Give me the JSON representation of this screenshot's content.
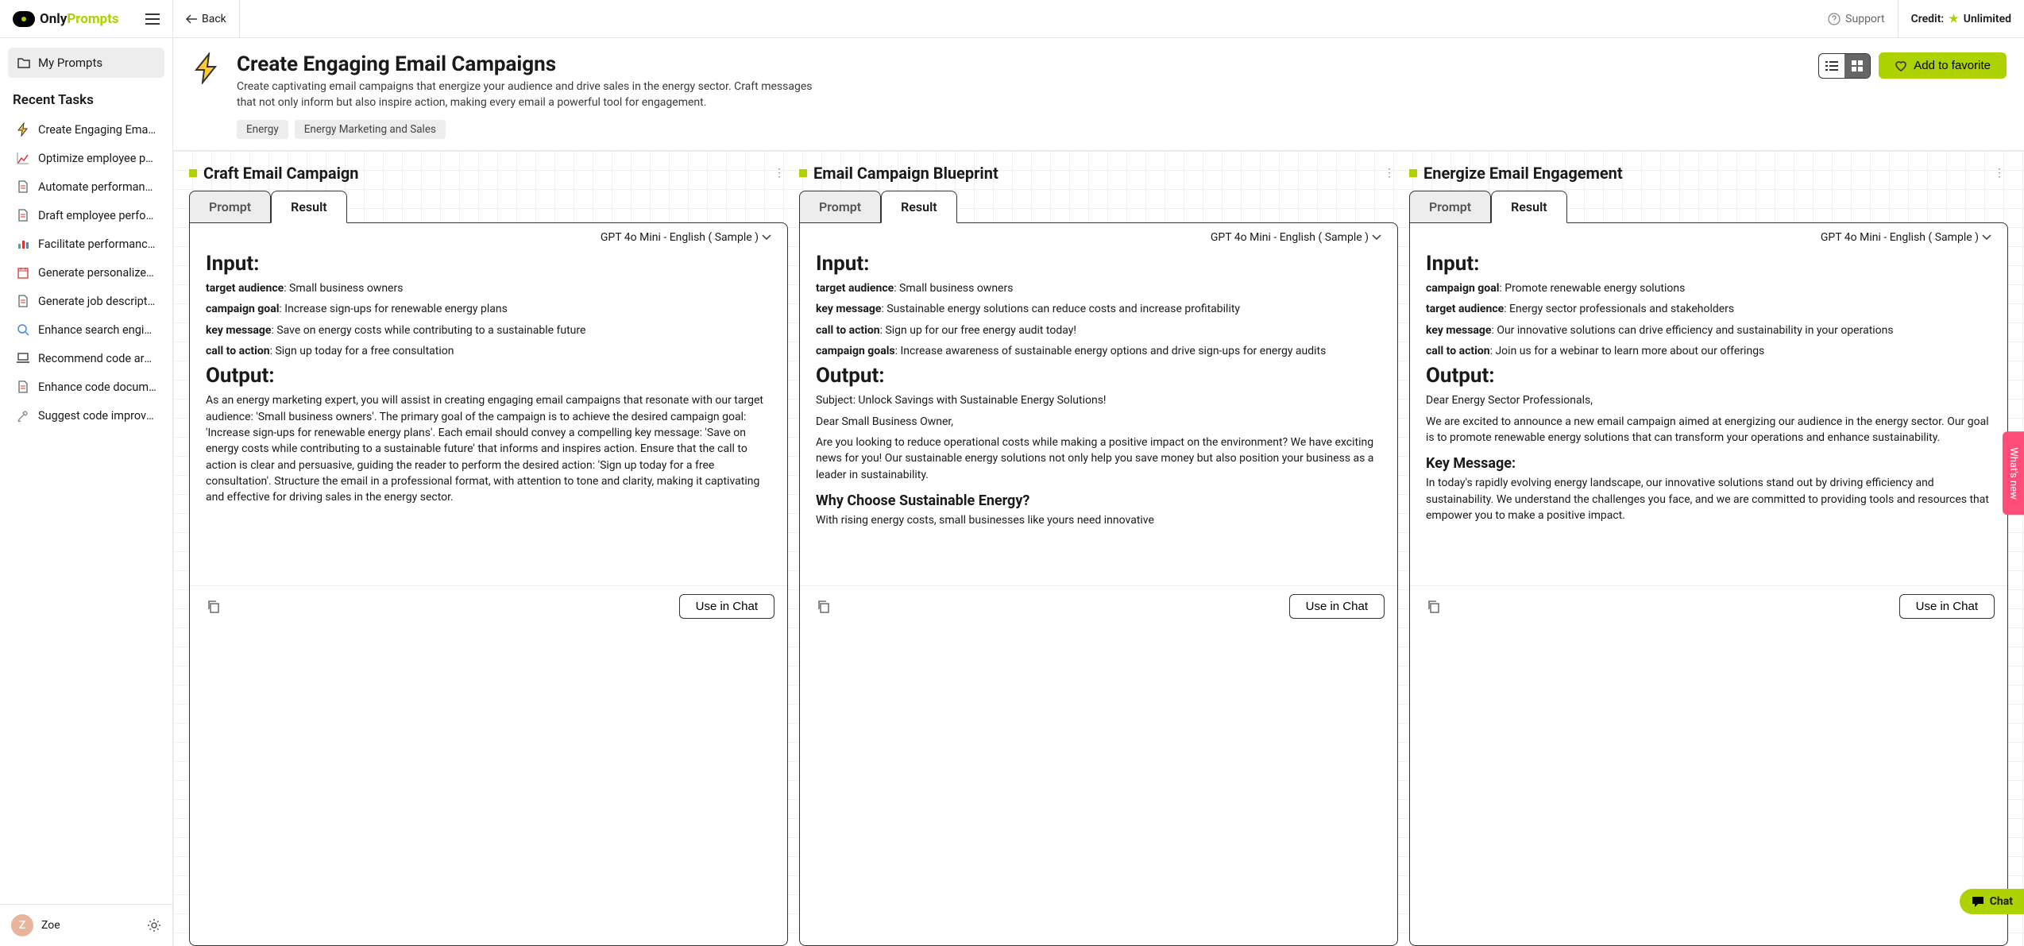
{
  "logo": {
    "only": "Only",
    "prompts": "Prompts"
  },
  "sidebar": {
    "myPrompts": "My Prompts",
    "recentHeading": "Recent Tasks",
    "items": [
      {
        "label": "Create Engaging Email C…",
        "icon": "bolt"
      },
      {
        "label": "Optimize employee perf…",
        "icon": "chart"
      },
      {
        "label": "Automate performance r…",
        "icon": "doc"
      },
      {
        "label": "Draft employee perform…",
        "icon": "doc"
      },
      {
        "label": "Facilitate performance r…",
        "icon": "bars"
      },
      {
        "label": "Generate personalized o…",
        "icon": "calendar"
      },
      {
        "label": "Generate job description…",
        "icon": "doc"
      },
      {
        "label": "Enhance search engine …",
        "icon": "search"
      },
      {
        "label": "Recommend code archit…",
        "icon": "laptop"
      },
      {
        "label": "Enhance code document…",
        "icon": "doc"
      },
      {
        "label": "Suggest code improvem…",
        "icon": "tools"
      }
    ]
  },
  "user": {
    "initial": "Z",
    "name": "Zoe"
  },
  "topbar": {
    "back": "Back",
    "support": "Support",
    "creditLabel": "Credit:",
    "creditValue": "Unlimited"
  },
  "hero": {
    "title": "Create Engaging Email Campaigns",
    "desc": "Create captivating email campaigns that energize your audience and drive sales in the energy sector. Craft messages that not only inform but also inspire action, making every email a powerful tool for engagement.",
    "tags": [
      "Energy",
      "Energy Marketing and Sales"
    ],
    "favorite": "Add to favorite"
  },
  "tabs": {
    "prompt": "Prompt",
    "result": "Result"
  },
  "model": "GPT 4o Mini - English ( Sample )",
  "useInChat": "Use in Chat",
  "cards": [
    {
      "title": "Craft Email Campaign",
      "input": {
        "target_audience": "Small business owners",
        "campaign_goal": "Increase sign-ups for renewable energy plans",
        "key_message": "Save on energy costs while contributing to a sustainable future",
        "call_to_action": "Sign up today for a free consultation"
      },
      "output": {
        "body": "As an energy marketing expert, you will assist in creating engaging email campaigns that resonate with our target audience: 'Small business owners'. The primary goal of the campaign is to achieve the desired campaign goal: 'Increase sign-ups for renewable energy plans'. Each email should convey a compelling key message: 'Save on energy costs while contributing to a sustainable future' that informs and inspires action. Ensure that the call to action is clear and persuasive, guiding the reader to perform the desired action: 'Sign up today for a free consultation'. Structure the email in a professional format, with attention to tone and clarity, making it captivating and effective for driving sales in the energy sector."
      }
    },
    {
      "title": "Email Campaign Blueprint",
      "input": {
        "target_audience": "Small business owners",
        "key_message": "Sustainable energy solutions can reduce costs and increase profitability",
        "call_to_action": "Sign up for our free energy audit today!",
        "campaign_goals": "Increase awareness of sustainable energy options and drive sign-ups for energy audits"
      },
      "output": {
        "subject": "Subject: Unlock Savings with Sustainable Energy Solutions!",
        "greeting": "Dear Small Business Owner,",
        "para1": "Are you looking to reduce operational costs while making a positive impact on the environment? We have exciting news for you! Our sustainable energy solutions not only help you save money but also position your business as a leader in sustainability.",
        "heading": "Why Choose Sustainable Energy?",
        "para2": "With rising energy costs, small businesses like yours need innovative"
      }
    },
    {
      "title": "Energize Email Engagement",
      "input": {
        "campaign_goal": "Promote renewable energy solutions",
        "target_audience": "Energy sector professionals and stakeholders",
        "key_message": "Our innovative solutions can drive efficiency and sustainability in your operations",
        "call_to_action": "Join us for a webinar to learn more about our offerings"
      },
      "output": {
        "greeting": "Dear Energy Sector Professionals,",
        "para1": "We are excited to announce a new email campaign aimed at energizing our audience in the energy sector. Our goal is to promote renewable energy solutions that can transform your operations and enhance sustainability.",
        "heading": "Key Message:",
        "para2": "In today's rapidly evolving energy landscape, our innovative solutions stand out by driving efficiency and sustainability. We understand the challenges you face, and we are committed to providing tools and resources that empower you to make a positive impact."
      }
    }
  ],
  "whatsNew": "What's new",
  "chat": "Chat"
}
